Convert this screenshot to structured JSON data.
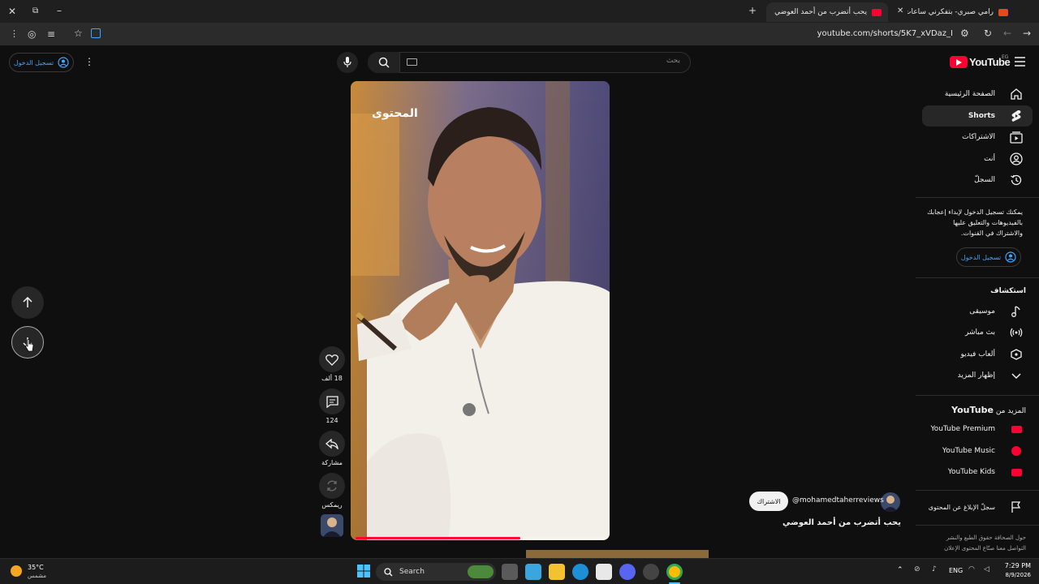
{
  "browser": {
    "tabs": [
      {
        "title": "يحب أتضرب من أحمد العوضي",
        "active": true
      },
      {
        "title": "رامي صبري- بتفكرني ساعات oud",
        "active": false
      }
    ],
    "url": "youtube.com/shorts/5K7_xVDaz_I",
    "new_tab_glyph": "+",
    "close_glyph": "✕",
    "minimize_glyph": "–"
  },
  "header": {
    "logo_text": "YouTube",
    "region": "EG",
    "search_placeholder": "بحث",
    "sign_in": "تسجيل الدخول"
  },
  "sidebar": {
    "main": [
      {
        "label": "الصفحة الرئيسية",
        "icon": "home-icon",
        "selected": false
      },
      {
        "label": "Shorts",
        "icon": "shorts-icon",
        "selected": true
      },
      {
        "label": "الاشتراكات",
        "icon": "subscriptions-icon",
        "selected": false
      },
      {
        "label": "أنت",
        "icon": "account-icon",
        "selected": false
      },
      {
        "label": "السجلّ",
        "icon": "history-icon",
        "selected": false
      }
    ],
    "signin_prompt": "يمكنك تسجيل الدخول لإبداء إعجابك بالفيديوهات والتعليق عليها والاشتراك في القنوات.",
    "signin_button": "تسجيل الدخول",
    "explore_title": "استكشاف",
    "explore": [
      {
        "label": "موسيقى",
        "icon": "music-icon"
      },
      {
        "label": "بث مباشر",
        "icon": "live-icon"
      },
      {
        "label": "ألعاب فيديو",
        "icon": "gaming-icon"
      },
      {
        "label": "إظهار المزيد",
        "icon": "chevron-down-icon"
      }
    ],
    "more_title_prefix": "المزيد من",
    "more_title_brand": "YouTube",
    "more": [
      {
        "label": "YouTube Premium",
        "icon": "youtube-premium-icon"
      },
      {
        "label": "YouTube Music",
        "icon": "youtube-music-icon"
      },
      {
        "label": "YouTube Kids",
        "icon": "youtube-kids-icon"
      }
    ],
    "report": "سجلّ الإبلاغ عن المحتوى",
    "footer_line1": "حول  الصحافة  حقوق الطبع والنشر",
    "footer_line2": "التواصل معنا  صنّاع المحتوى  الإعلان"
  },
  "short": {
    "watermark": "المحتوى",
    "channel": "@mohamedtaherreviews",
    "subscribe": "الاشتراك",
    "title": "يحب أتضرب من أحمد العوضي",
    "likes": "18 ألف",
    "comments": "124",
    "share": "مشاركة",
    "remix": "ريمكس",
    "progress_fraction": 0.66
  },
  "taskbar": {
    "weather_temp": "35°C",
    "weather_desc": "مشمس",
    "search": "Search",
    "lang": "ENG",
    "time": "7:29 PM",
    "date": "8/9/2026"
  }
}
